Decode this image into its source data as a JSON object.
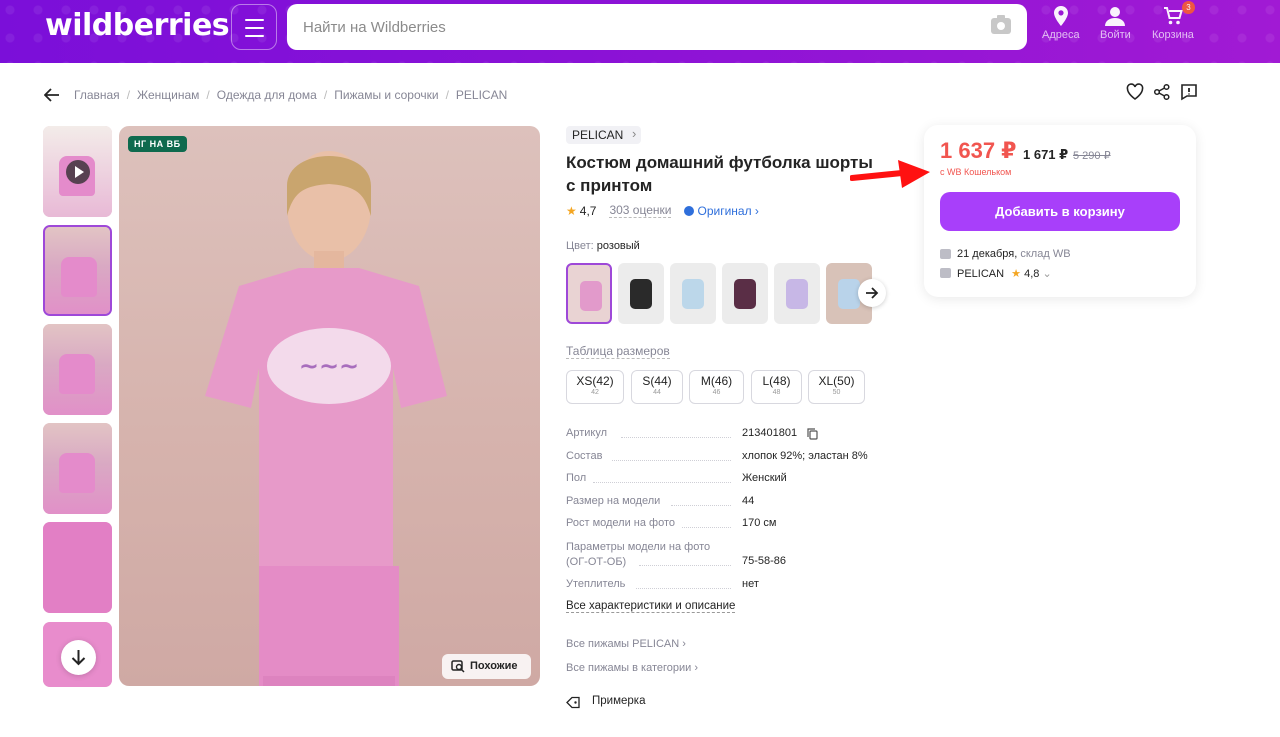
{
  "header": {
    "logo": "wildberries",
    "search_placeholder": "Найти на Wildberries",
    "addresses_label": "Адреса",
    "login_label": "Войти",
    "cart_label": "Корзина",
    "cart_count": "3"
  },
  "breadcrumbs": [
    "Главная",
    "Женщинам",
    "Одежда для дома",
    "Пижамы и сорочки",
    "PELICAN"
  ],
  "gallery": {
    "badge": "НГ НА ВБ",
    "similar_label": "Похожие"
  },
  "product": {
    "brand": "PELICAN",
    "title": "Костюм домашний футболка шорты с принтом",
    "rating": "4,7",
    "reviews": "303 оценки",
    "original_label": "Оригинал",
    "color_label": "Цвет:",
    "color_value": "розовый",
    "swatch_colors": [
      "#e29acb",
      "#2a2a2a",
      "#bcd7ea",
      "#5a2e46",
      "#c7b7e6",
      "#b9d3ea"
    ],
    "size_table_label": "Таблица размеров",
    "sizes": [
      {
        "label": "XS(42)",
        "sub": "42"
      },
      {
        "label": "S(44)",
        "sub": "44"
      },
      {
        "label": "M(46)",
        "sub": "46"
      },
      {
        "label": "L(48)",
        "sub": "48"
      },
      {
        "label": "XL(50)",
        "sub": "50"
      }
    ],
    "specs": [
      {
        "k": "Артикул",
        "v": "213401801"
      },
      {
        "k": "Состав",
        "v": "хлопок 92%; эластан 8%"
      },
      {
        "k": "Пол",
        "v": "Женский"
      },
      {
        "k": "Размер на модели",
        "v": "44"
      },
      {
        "k": "Рост модели на фото",
        "v": "170 см"
      },
      {
        "k": "Параметры модели на фото",
        "k2": "(ОГ-ОТ-ОБ)",
        "v": "75-58-86"
      },
      {
        "k": "Утеплитель",
        "v": "нет"
      }
    ],
    "all_chars_label": "Все характеристики и описание",
    "link_brand": "Все пижамы PELICAN",
    "link_category": "Все пижамы в категории",
    "fitting_label": "Примерка"
  },
  "price": {
    "main": "1 637 ₽",
    "alt": "1 671 ₽",
    "old": "5 290 ₽",
    "wallet_note": "с WB Кошельком",
    "add_to_cart": "Добавить в корзину",
    "delivery_date": "21 декабря,",
    "warehouse": "склад WB",
    "seller": "PELICAN",
    "seller_rating": "4,8"
  },
  "colors": {
    "accent": "#a83ffa",
    "price_red": "#f1554f",
    "header_purple": "#8a12d6"
  }
}
